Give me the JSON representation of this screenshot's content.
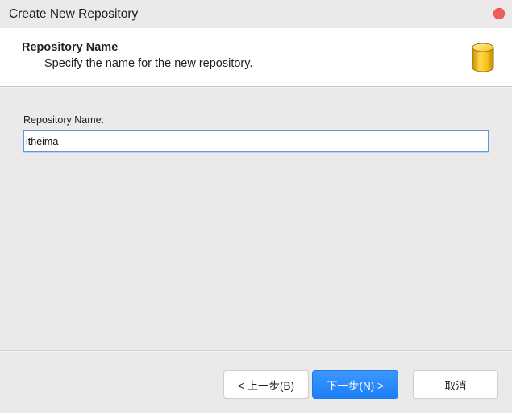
{
  "window": {
    "title": "Create New Repository"
  },
  "header": {
    "title": "Repository Name",
    "description": "Specify the name for the new repository.",
    "icon": "database-icon"
  },
  "form": {
    "repository_name_label": "Repository Name:",
    "repository_name_value": "itheima"
  },
  "buttons": {
    "back_label": "< 上一步(B)",
    "next_label": "下一步(N) >",
    "cancel_label": "取消"
  },
  "colors": {
    "close_button": "#ec5f5c",
    "primary_button": "#2a8bfb",
    "input_focus_border": "#5b9bd8",
    "database_icon": "#f4c21a"
  }
}
